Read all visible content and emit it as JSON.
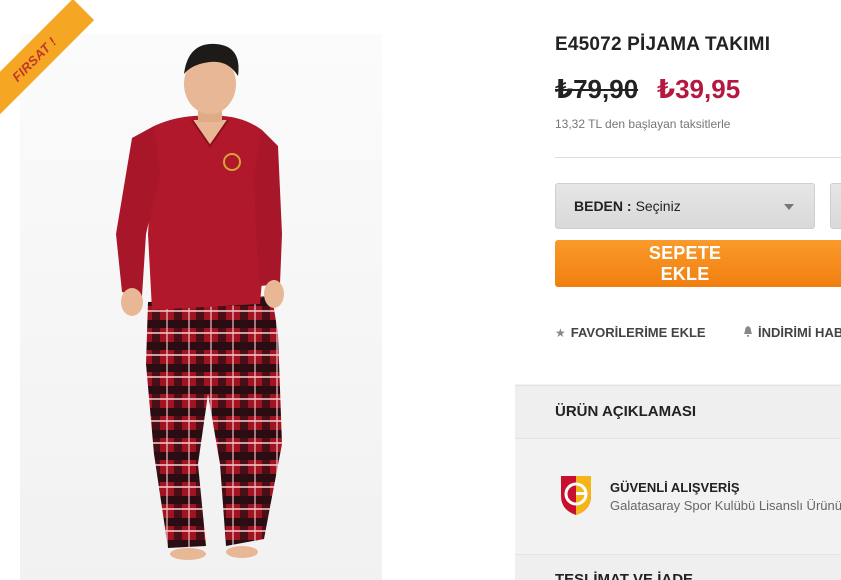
{
  "product": {
    "badge": "FIRSAT !",
    "title": "E45072 PİJAMA TAKIMI",
    "old_price": "₺79,90",
    "new_price": "₺39,95",
    "installment_text": "13,32 TL den başlayan taksitlerle"
  },
  "size_select": {
    "label": "BEDEN :",
    "value": "Seçiniz"
  },
  "actions": {
    "add_to_cart": "SEPETE EKLE",
    "favorites": "FAVORİLERİME EKLE",
    "notify": "İNDİRİMİ HABER"
  },
  "sections": {
    "description": "ÜRÜN AÇIKLAMASI",
    "secure_title": "GÜVENLİ ALIŞVERİŞ",
    "secure_sub": "Galatasaray Spor Kulübü Lisanslı Ürünü",
    "delivery": "TESLİMAT VE İADE"
  },
  "icons": {
    "favorites": "star-icon",
    "notify": "bell-icon",
    "select_caret": "caret-down-icon",
    "club_logo": "galatasaray-logo"
  },
  "colors": {
    "accent_orange": "#f58a1f",
    "price_red": "#b5173e",
    "badge_yellow": "#f5a623"
  }
}
